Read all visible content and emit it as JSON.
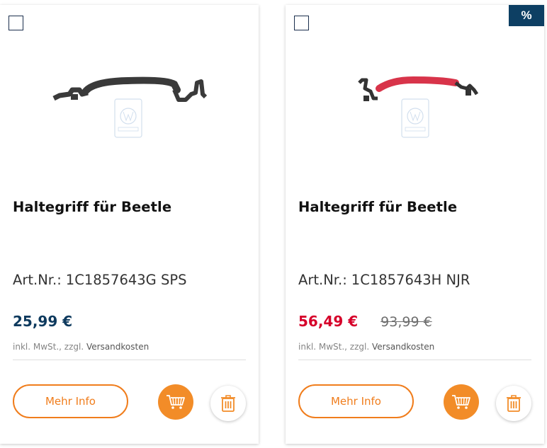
{
  "products": [
    {
      "title": "Haltegriff für Beetle",
      "artnr_label": "Art.Nr.:",
      "artnr_value": "1C1857643G SPS",
      "price": "25,99 €",
      "price_old": "",
      "on_sale": false,
      "handle_color": "#3a3a3a",
      "tax_prefix": "inkl. MwSt., zzgl. ",
      "shipping_link": "Versandkosten",
      "more_info_label": "Mehr Info",
      "icons": {
        "cart": "cart-icon",
        "delete": "trash-icon",
        "compare": "checkbox-icon"
      }
    },
    {
      "title": "Haltegriff für Beetle",
      "artnr_label": "Art.Nr.:",
      "artnr_value": "1C1857643H NJR",
      "price": "56,49 €",
      "price_old": "93,99 €",
      "on_sale": true,
      "discount_badge": "%",
      "handle_color": "#d8344a",
      "tax_prefix": "inkl. MwSt., zzgl. ",
      "shipping_link": "Versandkosten",
      "more_info_label": "Mehr Info",
      "icons": {
        "cart": "cart-icon",
        "delete": "trash-icon",
        "compare": "checkbox-icon"
      }
    }
  ],
  "colors": {
    "accent_orange": "#f28c28",
    "price_blue": "#0e3a5e",
    "sale_red": "#d6002a",
    "badge_navy": "#0d3f63"
  }
}
